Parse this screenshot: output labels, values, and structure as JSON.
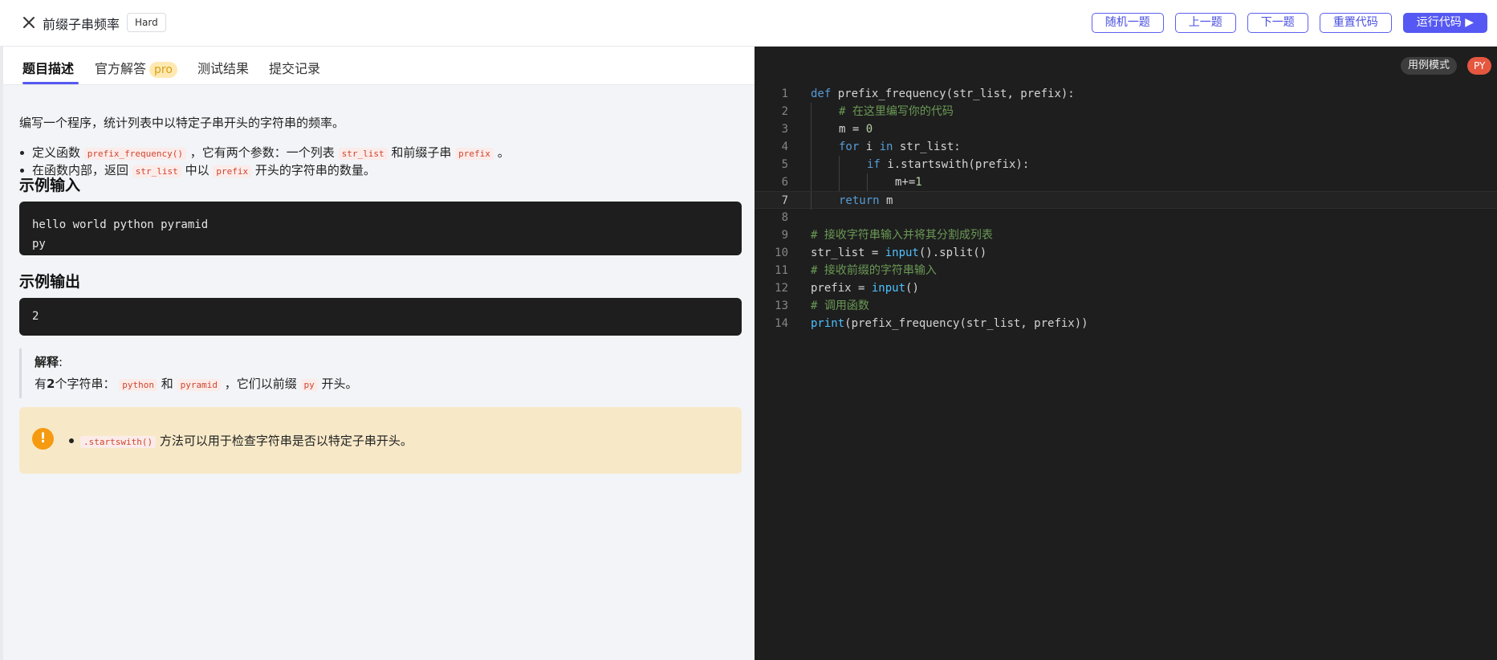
{
  "header": {
    "title": "前缀子串频率",
    "difficulty": "Hard",
    "buttons": {
      "random": "随机一题",
      "prev": "上一题",
      "next": "下一题",
      "reset": "重置代码",
      "run": "运行代码 ▶"
    }
  },
  "tabs": {
    "description": "题目描述",
    "solution": "官方解答",
    "pro": "pro",
    "results": "测试结果",
    "submissions": "提交记录"
  },
  "problem": {
    "intro": "编写一个程序，统计列表中以特定子串开头的字符串的频率。",
    "b1_a": "定义函数",
    "b1_code1": "prefix_frequency()",
    "b1_b": "，它有两个参数：一个列表",
    "b1_code2": "str_list",
    "b1_c": "和前缀子串",
    "b1_code3": "prefix",
    "b1_d": "。",
    "b2_a": "在函数内部，返回",
    "b2_code1": "str_list",
    "b2_b": "中以",
    "b2_code2": "prefix",
    "b2_c": "开头的字符串的数量。",
    "example_input_title": "示例输入",
    "example_input": "hello world python pyramid\npy",
    "example_output_title": "示例输出",
    "example_output": "2",
    "explain_label": "解释",
    "explain_colon": ":",
    "explain_a": "有",
    "explain_bold": "2",
    "explain_b": "个字符串：",
    "explain_code1": "python",
    "explain_c": "和",
    "explain_code2": "pyramid",
    "explain_d": "，它们以前缀",
    "explain_code3": "py",
    "explain_e": "开头。",
    "tip_code": ".startswith()",
    "tip_text": "方法可以用于检查字符串是否以特定子串开头。",
    "tip_icon": "!"
  },
  "editor": {
    "mode": "用例模式",
    "lang": "PY",
    "current_line": 7,
    "lines": [
      {
        "n": "1",
        "t": "def prefix_frequency(str_list, prefix):"
      },
      {
        "n": "2",
        "t": "    # 在这里编写你的代码"
      },
      {
        "n": "3",
        "t": "    m = 0"
      },
      {
        "n": "4",
        "t": "    for i in str_list:"
      },
      {
        "n": "5",
        "t": "        if i.startswith(prefix):"
      },
      {
        "n": "6",
        "t": "            m+=1"
      },
      {
        "n": "7",
        "t": "    return m"
      },
      {
        "n": "8",
        "t": ""
      },
      {
        "n": "9",
        "t": "# 接收字符串输入并将其分割成列表"
      },
      {
        "n": "10",
        "t": "str_list = input().split()"
      },
      {
        "n": "11",
        "t": "# 接收前缀的字符串输入"
      },
      {
        "n": "12",
        "t": "prefix = input()"
      },
      {
        "n": "13",
        "t": "# 调用函数"
      },
      {
        "n": "14",
        "t": "print(prefix_frequency(str_list, prefix))"
      }
    ]
  }
}
